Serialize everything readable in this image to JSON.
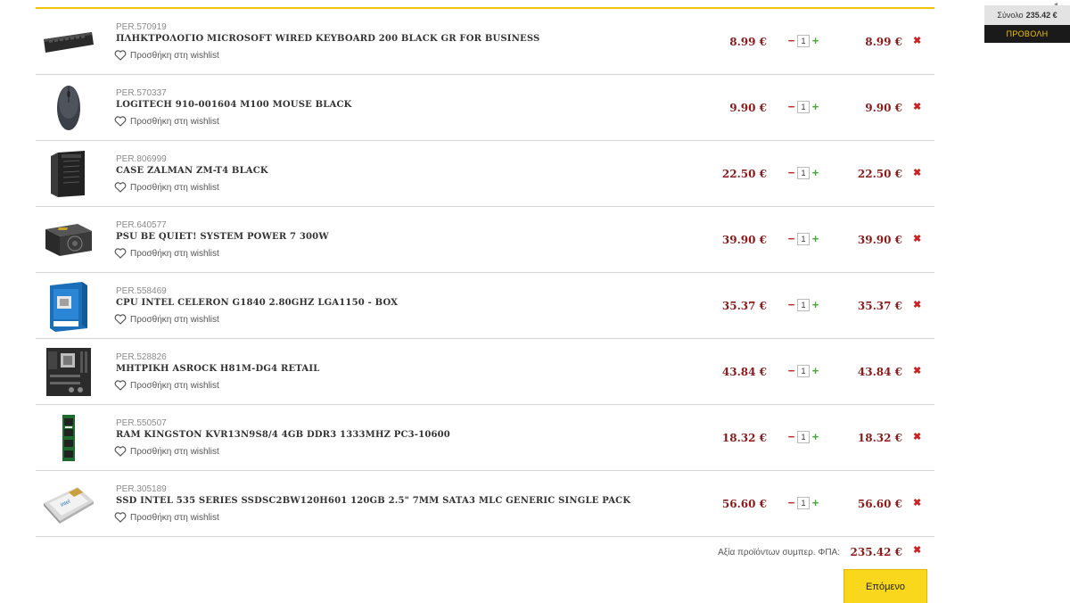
{
  "mini_cart": {
    "label": "Σύνολο",
    "amount": "235.42 €",
    "view_label": "ΠΡΟΒΟΛΗ"
  },
  "wishlist_label": "Προσθήκη στη wishlist",
  "items": [
    {
      "code": "PER.570919",
      "title": "ΠΛΗΚΤΡΟΛΟΓΙΟ MICROSOFT WIRED KEYBOARD 200 BLACK GR FOR BUSINESS",
      "price": "8.99 €",
      "qty": "1",
      "total": "8.99 €",
      "icon": "keyboard-icon"
    },
    {
      "code": "PER.570337",
      "title": "LOGITECH 910-001604 M100 MOUSE BLACK",
      "price": "9.90 €",
      "qty": "1",
      "total": "9.90 €",
      "icon": "mouse-icon"
    },
    {
      "code": "PER.806999",
      "title": "CASE ZALMAN ZM-T4 BLACK",
      "price": "22.50 €",
      "qty": "1",
      "total": "22.50 €",
      "icon": "pc-case-icon"
    },
    {
      "code": "PER.640577",
      "title": "PSU BE QUIET! SYSTEM POWER 7 300W",
      "price": "39.90 €",
      "qty": "1",
      "total": "39.90 €",
      "icon": "power-supply-icon"
    },
    {
      "code": "PER.558469",
      "title": "CPU INTEL CELERON G1840 2.80GHZ LGA1150 - BOX",
      "price": "35.37 €",
      "qty": "1",
      "total": "35.37 €",
      "icon": "cpu-box-icon"
    },
    {
      "code": "PER.528826",
      "title": "ΜΗΤΡΙΚΗ ASROCK H81M-DG4 RETAIL",
      "price": "43.84 €",
      "qty": "1",
      "total": "43.84 €",
      "icon": "motherboard-icon"
    },
    {
      "code": "PER.550507",
      "title": "RAM KINGSTON KVR13N9S8/4 4GB DDR3 1333MHZ PC3-10600",
      "price": "18.32 €",
      "qty": "1",
      "total": "18.32 €",
      "icon": "ram-module-icon"
    },
    {
      "code": "PER.305189",
      "title": "SSD INTEL 535 SERIES SSDSC2BW120H601 120GB 2.5\" 7MM SATA3 MLC GENERIC SINGLE PACK",
      "price": "56.60 €",
      "qty": "1",
      "total": "56.60 €",
      "icon": "ssd-icon"
    }
  ],
  "summary": {
    "label": "Αξία προϊόντων συμπερ. ΦΠΑ:",
    "total": "235.42 €"
  },
  "next_button_label": "Επόμενο",
  "colors": {
    "accent_yellow": "#f9d71c",
    "price_red": "#8b1a1a",
    "remove_red": "#cc2222",
    "plus_green": "#44aa33"
  }
}
